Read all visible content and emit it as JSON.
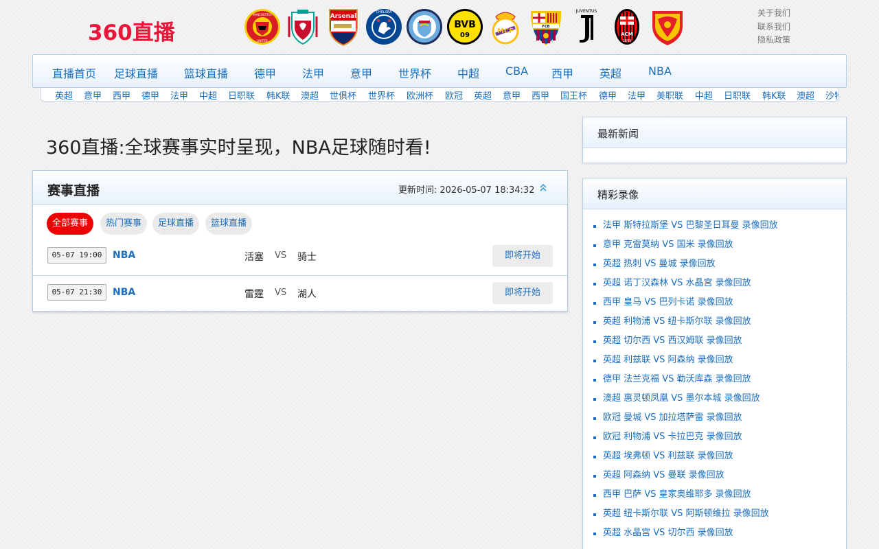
{
  "site": {
    "logo": "360直播"
  },
  "club_logos": [
    {
      "name": "manchester-united",
      "text": "MANCHESTER UNITED",
      "primary": "#d81e24",
      "secondary": "#f6d000"
    },
    {
      "name": "liverpool",
      "text": "LIVERPOOL FC",
      "primary": "#c8102e",
      "secondary": "#00a398"
    },
    {
      "name": "arsenal",
      "text": "Arsenal",
      "primary": "#db0007",
      "secondary": "#0b2a6b"
    },
    {
      "name": "chelsea",
      "text": "CHELSEA FOOTBALL CLUB",
      "primary": "#034694",
      "secondary": "#ffffff"
    },
    {
      "name": "manchester-city",
      "text": "MANCHESTER CITY",
      "primary": "#6cabdd",
      "secondary": "#1c2c5b"
    },
    {
      "name": "borussia-dortmund",
      "text": "BVB 09",
      "primary": "#fde100",
      "secondary": "#000000"
    },
    {
      "name": "real-madrid",
      "text": "RMCF",
      "primary": "#febe10",
      "secondary": "#00529f"
    },
    {
      "name": "barcelona",
      "text": "FCB",
      "primary": "#a50044",
      "secondary": "#004d98"
    },
    {
      "name": "juventus",
      "text": "JUVENTUS",
      "primary": "#000000",
      "secondary": "#ffffff"
    },
    {
      "name": "ac-milan",
      "text": "ACM 1899",
      "primary": "#fb090b",
      "secondary": "#000000"
    },
    {
      "name": "guangzhou",
      "text": "",
      "primary": "#e41e26",
      "secondary": "#f6c500"
    }
  ],
  "top_links": [
    "关于我们",
    "联系我们",
    "隐私政策"
  ],
  "main_nav": [
    "直播首页",
    "足球直播",
    "篮球直播",
    "德甲",
    "法甲",
    "意甲",
    "世界杯",
    "中超",
    "CBA",
    "西甲",
    "英超",
    "NBA"
  ],
  "sub_nav": [
    "英超",
    "意甲",
    "西甲",
    "德甲",
    "法甲",
    "中超",
    "日职联",
    "韩K联",
    "澳超",
    "世俱杯",
    "世界杯",
    "欧洲杯",
    "欧冠",
    "英超",
    "意甲",
    "西甲",
    "国王杯",
    "德甲",
    "法甲",
    "美职联",
    "中超",
    "日职联",
    "韩K联",
    "澳超",
    "沙特"
  ],
  "page_title": "360直播:全球赛事实时呈现，NBA足球随时看!",
  "live": {
    "title": "赛事直播",
    "update_label": "更新时间:",
    "update_time": "2026-05-07 18:34:32",
    "filters": [
      "全部赛事",
      "热门赛事",
      "足球直播",
      "篮球直播"
    ],
    "active_filter": 0,
    "matches": [
      {
        "time": "05-07 19:00",
        "league": "NBA",
        "home": "活塞",
        "vs": "VS",
        "away": "骑士",
        "status": "即将开始"
      },
      {
        "time": "05-07 21:30",
        "league": "NBA",
        "home": "雷霆",
        "vs": "VS",
        "away": "湖人",
        "status": "即将开始"
      }
    ]
  },
  "news": {
    "title": "最新新闻",
    "items": []
  },
  "videos": {
    "title": "精彩录像",
    "items": [
      "法甲 斯特拉斯堡 VS 巴黎圣日耳曼 录像回放",
      "意甲 克雷莫纳 VS 国米 录像回放",
      "英超 热刺 VS 曼城 录像回放",
      "英超 诺丁汉森林 VS 水晶宫 录像回放",
      "西甲 皇马 VS 巴列卡诺 录像回放",
      "英超 利物浦 VS 纽卡斯尔联 录像回放",
      "英超 切尔西 VS 西汉姆联 录像回放",
      "英超 利兹联 VS 阿森纳 录像回放",
      "德甲 法兰克福 VS 勒沃库森 录像回放",
      "澳超 惠灵顿凤凰 VS 墨尔本城 录像回放",
      "欧冠 曼城 VS 加拉塔萨雷 录像回放",
      "欧冠 利物浦 VS 卡拉巴克 录像回放",
      "英超 埃弗顿 VS 利兹联 录像回放",
      "英超 阿森纳 VS 曼联 录像回放",
      "西甲 巴萨 VS 皇家奥维耶多 录像回放",
      "英超 纽卡斯尔联 VS 阿斯顿维拉 录像回放",
      "英超 水晶宫 VS 切尔西 录像回放"
    ]
  },
  "colors": {
    "accent": "#1a6fc0",
    "logo": "#e8173a",
    "active_pill": "#ee0000"
  }
}
